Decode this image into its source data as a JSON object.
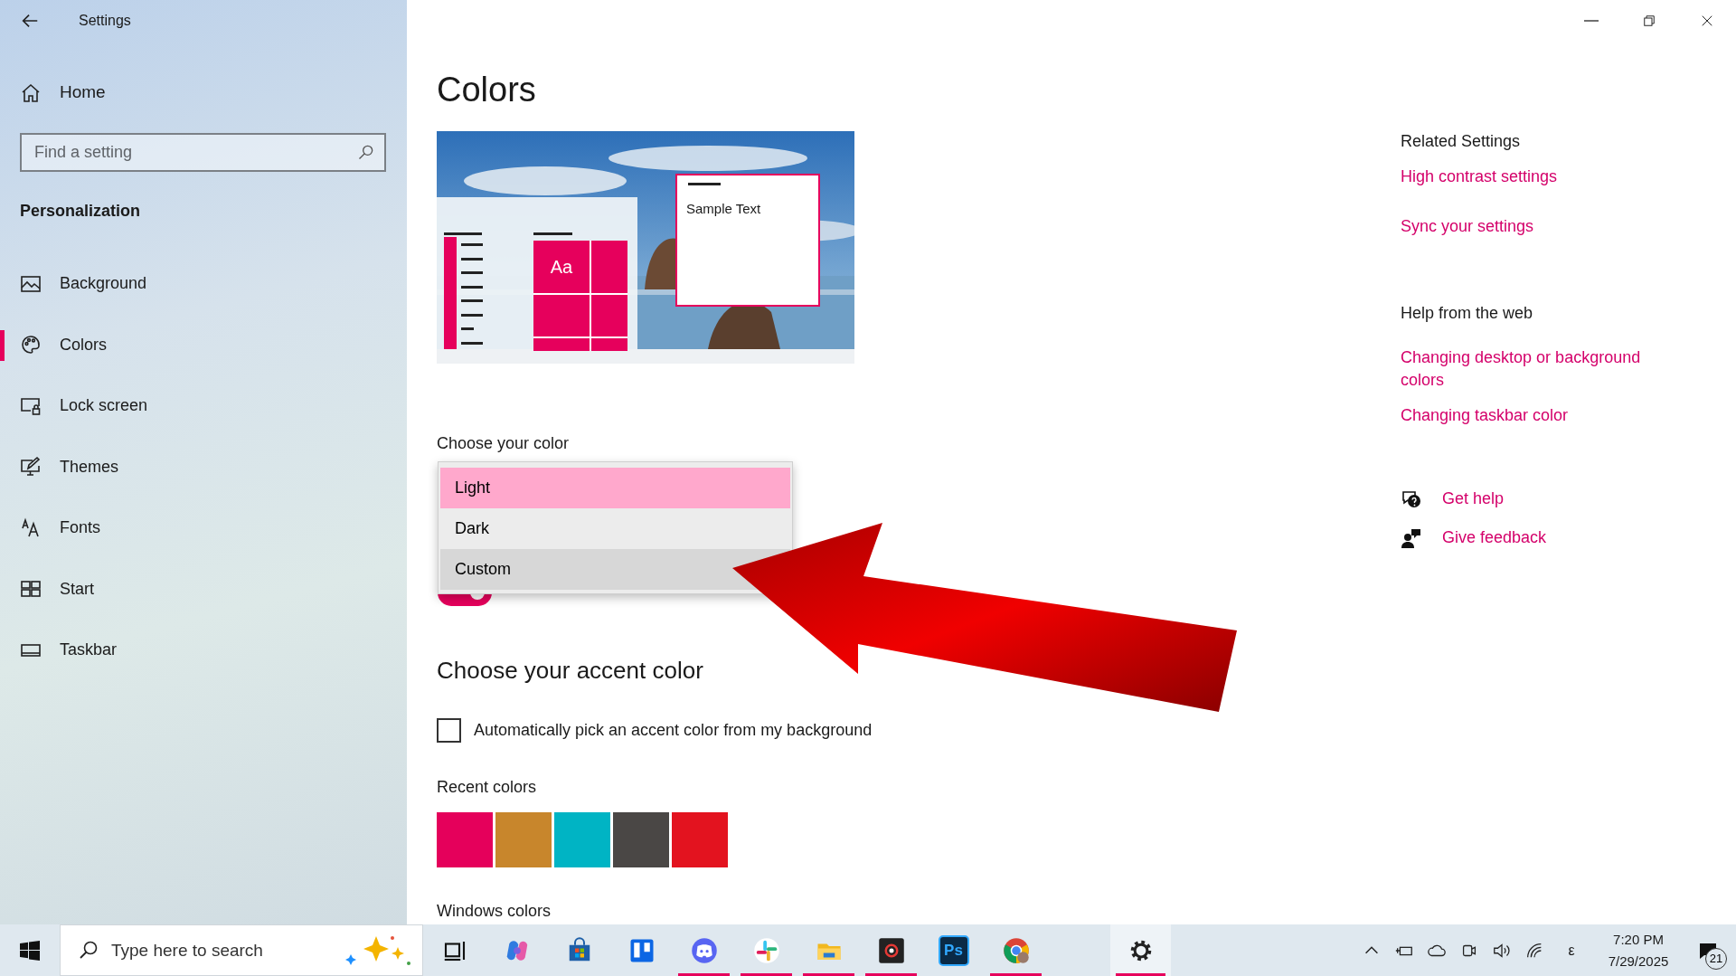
{
  "window": {
    "title": "Settings"
  },
  "sidebar": {
    "home": "Home",
    "search": {
      "placeholder": "Find a setting"
    },
    "section": "Personalization",
    "items": [
      {
        "kind": "background",
        "label": "Background",
        "selected": false
      },
      {
        "kind": "colors",
        "label": "Colors",
        "selected": true
      },
      {
        "kind": "lock-screen",
        "label": "Lock screen",
        "selected": false
      },
      {
        "kind": "themes",
        "label": "Themes",
        "selected": false
      },
      {
        "kind": "fonts",
        "label": "Fonts",
        "selected": false
      },
      {
        "kind": "start",
        "label": "Start",
        "selected": false
      },
      {
        "kind": "taskbar",
        "label": "Taskbar",
        "selected": false
      }
    ]
  },
  "page": {
    "title": "Colors",
    "preview": {
      "tile_text": "Aa",
      "sample_text": "Sample Text"
    },
    "choose_color": {
      "label": "Choose your color",
      "options": [
        {
          "label": "Light",
          "selected": true,
          "hovered": false
        },
        {
          "label": "Dark",
          "selected": false,
          "hovered": false
        },
        {
          "label": "Custom",
          "selected": false,
          "hovered": true
        }
      ]
    },
    "transparency_toggle": {
      "on": true
    },
    "accent": {
      "heading": "Choose your accent color",
      "auto_pick": {
        "label": "Automatically pick an accent color from my background",
        "checked": false
      },
      "recent_label": "Recent colors",
      "recent_colors": [
        {
          "color": "#e5005b"
        },
        {
          "color": "#c8862c"
        },
        {
          "color": "#00b4c4"
        },
        {
          "color": "#4a4745"
        },
        {
          "color": "#e3131f"
        }
      ],
      "windows_colors_label": "Windows colors"
    }
  },
  "related": {
    "heading": "Related Settings",
    "links": [
      "High contrast settings",
      "Sync your settings"
    ]
  },
  "help": {
    "heading": "Help from the web",
    "links": [
      "Changing desktop or background colors",
      "Changing taskbar color"
    ]
  },
  "support": [
    {
      "kind": "help",
      "label": "Get help"
    },
    {
      "kind": "feedback",
      "label": "Give feedback"
    }
  ],
  "taskbar": {
    "search": {
      "placeholder": "Type here to search"
    },
    "apps": [
      {
        "kind": "task-view",
        "running": false,
        "active": false
      },
      {
        "kind": "copilot",
        "running": false,
        "active": false
      },
      {
        "kind": "store",
        "running": false,
        "active": false
      },
      {
        "kind": "trello",
        "running": false,
        "active": false
      },
      {
        "kind": "discord",
        "running": true,
        "active": false
      },
      {
        "kind": "slack",
        "running": true,
        "active": false
      },
      {
        "kind": "explorer",
        "running": true,
        "active": false
      },
      {
        "kind": "recorder",
        "running": true,
        "active": false
      },
      {
        "kind": "photoshop",
        "glyph": "Ps",
        "running": false,
        "active": false
      },
      {
        "kind": "chrome",
        "running": true,
        "active": false
      },
      {
        "kind": "settings",
        "running": true,
        "active": true
      }
    ],
    "tray": {
      "input_indicator": "ε",
      "time": "7:20 PM",
      "date": "7/29/2025",
      "notifications": "21"
    }
  }
}
